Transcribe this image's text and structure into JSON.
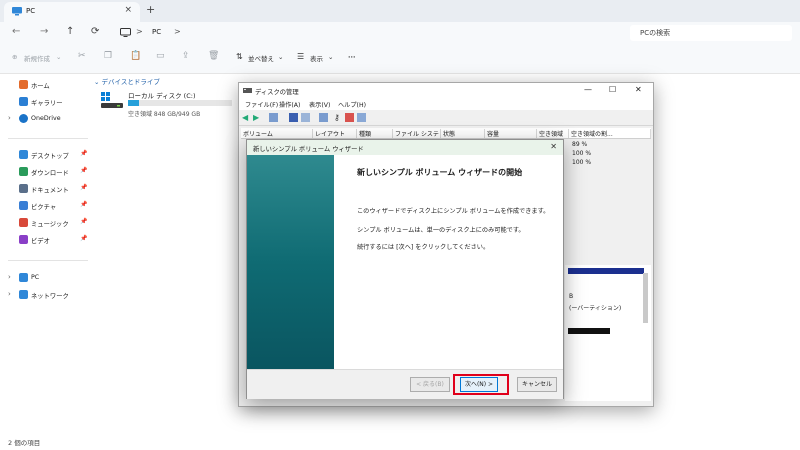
{
  "explorer": {
    "tab_title": "PC",
    "tab_close": "×",
    "new_tab": "+",
    "nav": {
      "back": "←",
      "forward": "→",
      "up": "↑",
      "refresh": "⟳"
    },
    "breadcrumb": "PC",
    "breadcrumb_sep": ">",
    "search_placeholder": "PCの検索",
    "toolbar": {
      "new_label": "新規作成",
      "sort_label": "並べ替え",
      "view_label": "表示",
      "more_label": "···"
    },
    "sidebar": {
      "items": [
        {
          "label": "ホーム",
          "icon": "home-icon",
          "color": "#e36b2c"
        },
        {
          "label": "ギャラリー",
          "icon": "gallery-icon",
          "color": "#2b7fd4"
        },
        {
          "label": "OneDrive",
          "icon": "cloud-icon",
          "color": "#1a73c8"
        },
        {
          "label": "デスクトップ",
          "icon": "desktop-icon",
          "color": "#2f87d8"
        },
        {
          "label": "ダウンロード",
          "icon": "download-icon",
          "color": "#2a9b5b"
        },
        {
          "label": "ドキュメント",
          "icon": "document-icon",
          "color": "#5a6f8a"
        },
        {
          "label": "ピクチャ",
          "icon": "pictures-icon",
          "color": "#3a7fd5"
        },
        {
          "label": "ミュージック",
          "icon": "music-icon",
          "color": "#d8493a"
        },
        {
          "label": "ビデオ",
          "icon": "video-icon",
          "color": "#8a3fc7"
        },
        {
          "label": "PC",
          "icon": "pc-icon",
          "color": "#2f87d8"
        },
        {
          "label": "ネットワーク",
          "icon": "network-icon",
          "color": "#2f87d8"
        }
      ]
    },
    "section_header": "デバイスとドライブ",
    "drive": {
      "name": "ローカル ディスク (C:)",
      "free_text": "空き領域 848 GB/949 GB",
      "used_fraction": 0.107
    },
    "status": "2 個の項目"
  },
  "disk_mgmt": {
    "title": "ディスクの管理",
    "window_controls": {
      "minimize": "—",
      "maximize": "☐",
      "close": "✕"
    },
    "menu": [
      "ファイル(F)",
      "操作(A)",
      "表示(V)",
      "ヘルプ(H)"
    ],
    "columns": [
      "ボリューム",
      "レイアウト",
      "種類",
      "ファイル システム",
      "状態",
      "容量",
      "空き領域",
      "空き領域の割..."
    ],
    "free_percent": [
      "89 %",
      "100 %",
      "100 %"
    ],
    "partition_lines": [
      "B",
      "(ーバーティション)"
    ]
  },
  "wizard": {
    "title": "新しいシンプル ボリューム ウィザード",
    "close": "✕",
    "heading": "新しいシンプル ボリューム ウィザードの開始",
    "paragraphs": [
      "このウィザードでディスク上にシンプル ボリュームを作成できます。",
      "シンプル ボリュームは、単一のディスク上にのみ可能です。",
      "続行するには [次へ] をクリックしてください。"
    ],
    "buttons": {
      "back": "< 戻る(B)",
      "next": "次へ(N) >",
      "cancel": "キャンセル"
    },
    "highlight_color": "#e0001b"
  }
}
